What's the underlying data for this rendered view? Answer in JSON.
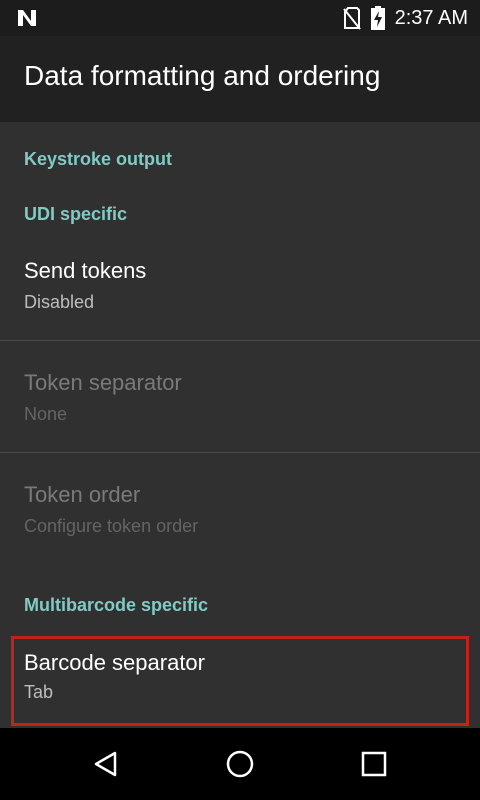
{
  "status_bar": {
    "time": "2:37 AM",
    "icons": [
      "notification-n-icon",
      "no-sim-icon",
      "battery-charging-icon"
    ]
  },
  "app_bar": {
    "title": "Data formatting and ordering"
  },
  "preferences": {
    "category_keystroke": "Keystroke output",
    "category_udi": "UDI specific",
    "send_tokens": {
      "title": "Send tokens",
      "summary": "Disabled"
    },
    "token_separator": {
      "title": "Token separator",
      "summary": "None"
    },
    "token_order": {
      "title": "Token order",
      "summary": "Configure token order"
    },
    "category_multibarcode": "Multibarcode specific",
    "barcode_separator": {
      "title": "Barcode separator",
      "summary": "Tab"
    }
  },
  "nav_bar": {
    "icons": [
      "back-icon",
      "home-icon",
      "recents-icon"
    ]
  },
  "colors": {
    "accent": "#80cbc4",
    "highlight": "#c0231a",
    "background": "#303030",
    "app_bar": "#212121"
  }
}
